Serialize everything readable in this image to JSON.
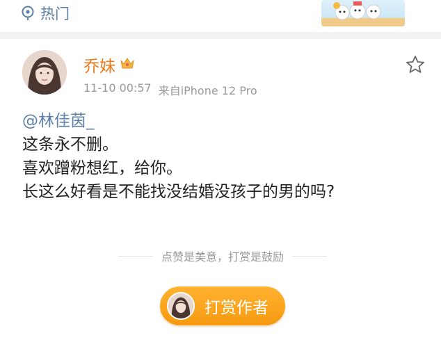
{
  "header": {
    "topic_label": "热门"
  },
  "post": {
    "author": "乔妹",
    "timestamp": "11-10 00:57",
    "source": "来自iPhone 12 Pro",
    "mention": "@林佳茵_",
    "lines": [
      "这条永不删。",
      "喜欢蹭粉想红，给你。",
      "长这么好看是不能找没结婚没孩子的男的吗?"
    ]
  },
  "reward": {
    "hint": "点赞是美意，打赏是鼓励",
    "button_label": "打赏作者"
  },
  "colors": {
    "link": "#5b7fa8",
    "username": "#f07a1a",
    "reward_button": "#f79a12",
    "meta_text": "#9a9a9a"
  },
  "icons": {
    "topic": "location-pin-icon",
    "vip": "crown-icon",
    "favorite": "star-outline-icon"
  }
}
